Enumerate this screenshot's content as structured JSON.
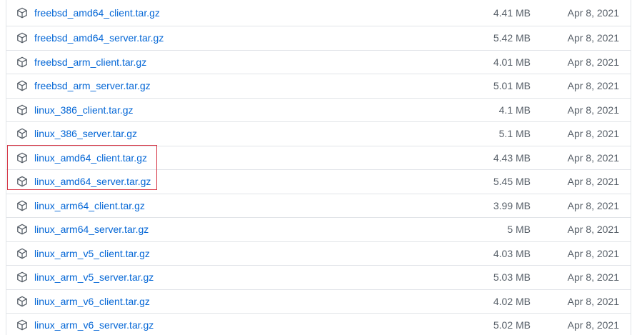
{
  "icon": "package-icon",
  "colors": {
    "link": "#0366d6",
    "muted": "#586069",
    "border": "#e1e4e8",
    "highlight": "#d73a49"
  },
  "assets": [
    {
      "name": "freebsd_amd64_client.tar.gz",
      "size": "4.41 MB",
      "date": "Apr 8, 2021"
    },
    {
      "name": "freebsd_amd64_server.tar.gz",
      "size": "5.42 MB",
      "date": "Apr 8, 2021"
    },
    {
      "name": "freebsd_arm_client.tar.gz",
      "size": "4.01 MB",
      "date": "Apr 8, 2021"
    },
    {
      "name": "freebsd_arm_server.tar.gz",
      "size": "5.01 MB",
      "date": "Apr 8, 2021"
    },
    {
      "name": "linux_386_client.tar.gz",
      "size": "4.1 MB",
      "date": "Apr 8, 2021"
    },
    {
      "name": "linux_386_server.tar.gz",
      "size": "5.1 MB",
      "date": "Apr 8, 2021"
    },
    {
      "name": "linux_amd64_client.tar.gz",
      "size": "4.43 MB",
      "date": "Apr 8, 2021"
    },
    {
      "name": "linux_amd64_server.tar.gz",
      "size": "5.45 MB",
      "date": "Apr 8, 2021"
    },
    {
      "name": "linux_arm64_client.tar.gz",
      "size": "3.99 MB",
      "date": "Apr 8, 2021"
    },
    {
      "name": "linux_arm64_server.tar.gz",
      "size": "5 MB",
      "date": "Apr 8, 2021"
    },
    {
      "name": "linux_arm_v5_client.tar.gz",
      "size": "4.03 MB",
      "date": "Apr 8, 2021"
    },
    {
      "name": "linux_arm_v5_server.tar.gz",
      "size": "5.03 MB",
      "date": "Apr 8, 2021"
    },
    {
      "name": "linux_arm_v6_client.tar.gz",
      "size": "4.02 MB",
      "date": "Apr 8, 2021"
    },
    {
      "name": "linux_arm_v6_server.tar.gz",
      "size": "5.02 MB",
      "date": "Apr 8, 2021"
    }
  ]
}
